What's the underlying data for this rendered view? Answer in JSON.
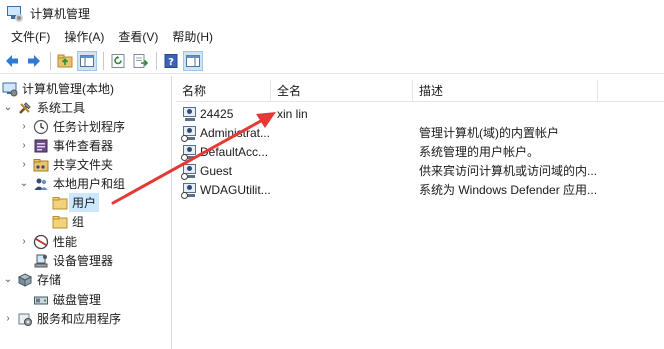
{
  "window": {
    "title": "计算机管理"
  },
  "menu": [
    {
      "label": "文件(F)"
    },
    {
      "label": "操作(A)"
    },
    {
      "label": "查看(V)"
    },
    {
      "label": "帮助(H)"
    }
  ],
  "tree": {
    "root": "计算机管理(本地)",
    "system_tools": "系统工具",
    "task_scheduler": "任务计划程序",
    "event_viewer": "事件查看器",
    "shared_folders": "共享文件夹",
    "local_users_groups": "本地用户和组",
    "users": "用户",
    "groups": "组",
    "performance": "性能",
    "device_manager": "设备管理器",
    "storage": "存储",
    "disk_management": "磁盘管理",
    "services_apps": "服务和应用程序"
  },
  "list": {
    "headers": {
      "name": "名称",
      "fullname": "全名",
      "description": "描述"
    },
    "rows": [
      {
        "name": "24425",
        "fullname": "xin lin",
        "description": ""
      },
      {
        "name": "Administrat...",
        "fullname": "",
        "description": "管理计算机(域)的内置帐户"
      },
      {
        "name": "DefaultAcc...",
        "fullname": "",
        "description": "系统管理的用户帐户。"
      },
      {
        "name": "Guest",
        "fullname": "",
        "description": "供来宾访问计算机或访问域的内..."
      },
      {
        "name": "WDAGUtilit...",
        "fullname": "",
        "description": "系统为 Windows Defender 应用..."
      }
    ]
  },
  "annotation": {
    "arrow_color": "#e53935"
  }
}
